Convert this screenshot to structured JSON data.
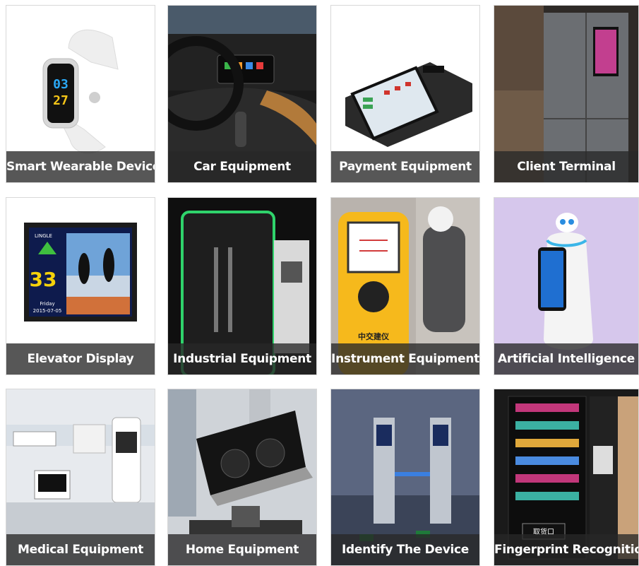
{
  "products": [
    {
      "label": "Smart Wearable Device",
      "icon": "smartwatch-icon"
    },
    {
      "label": "Car Equipment",
      "icon": "car-dashboard-icon"
    },
    {
      "label": "Payment Equipment",
      "icon": "pos-terminal-icon"
    },
    {
      "label": "Client Terminal",
      "icon": "refrigerator-screen-icon"
    },
    {
      "label": "Elevator Display",
      "icon": "elevator-display-icon"
    },
    {
      "label": "Industrial Equipment",
      "icon": "industrial-cabinet-icon"
    },
    {
      "label": "Instrument Equipment",
      "icon": "handheld-instrument-icon"
    },
    {
      "label": "Artificial Intelligence",
      "icon": "robot-icon"
    },
    {
      "label": "Medical Equipment",
      "icon": "medical-monitor-icon"
    },
    {
      "label": "Home Equipment",
      "icon": "range-hood-icon"
    },
    {
      "label": "Identify The Device",
      "icon": "turnstile-gate-icon"
    },
    {
      "label": "Fingerprint Recognition",
      "icon": "vending-machine-icon"
    }
  ],
  "screen_text": {
    "watch_hour": "03",
    "watch_minute": "27",
    "elevator_brand": "LINGLE",
    "elevator_floor": "33",
    "elevator_day": "Friday",
    "elevator_date": "2015-07-05",
    "instrument_brand": "中交建仪",
    "vending_sign": "取货口"
  },
  "colors": {
    "caption_bg": "#282828",
    "caption_text": "#ffffff",
    "instrument_yellow": "#f6b91c",
    "watch_blue": "#2aa8f5",
    "watch_yellow": "#f5c518"
  }
}
